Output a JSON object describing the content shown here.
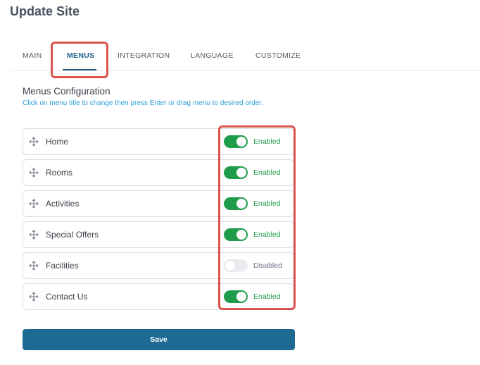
{
  "page": {
    "title": "Update Site"
  },
  "tabs": [
    {
      "label": "MAIN",
      "active": false
    },
    {
      "label": "MENUS",
      "active": true
    },
    {
      "label": "INTEGRATION",
      "active": false
    },
    {
      "label": "LANGUAGE",
      "active": false
    },
    {
      "label": "CUSTOMIZE",
      "active": false
    }
  ],
  "section": {
    "title": "Menus Configuration",
    "subtitle": "Click on menu title to change then press Enter or drag menu to desired order."
  },
  "menus": [
    {
      "label": "Home",
      "enabled": true,
      "status": "Enabled"
    },
    {
      "label": "Rooms",
      "enabled": true,
      "status": "Enabled"
    },
    {
      "label": "Activities",
      "enabled": true,
      "status": "Enabled"
    },
    {
      "label": "Special Offers",
      "enabled": true,
      "status": "Enabled"
    },
    {
      "label": "Facilities",
      "enabled": false,
      "status": "Disabled"
    },
    {
      "label": "Contact Us",
      "enabled": true,
      "status": "Enabled"
    }
  ],
  "actions": {
    "save_label": "Save"
  },
  "colors": {
    "accent": "#1f6a94",
    "enabled": "#1e9c4b",
    "highlight": "#d9534f",
    "hint": "#2a9fd6"
  },
  "icons": {
    "drag": "move-arrows-icon"
  }
}
